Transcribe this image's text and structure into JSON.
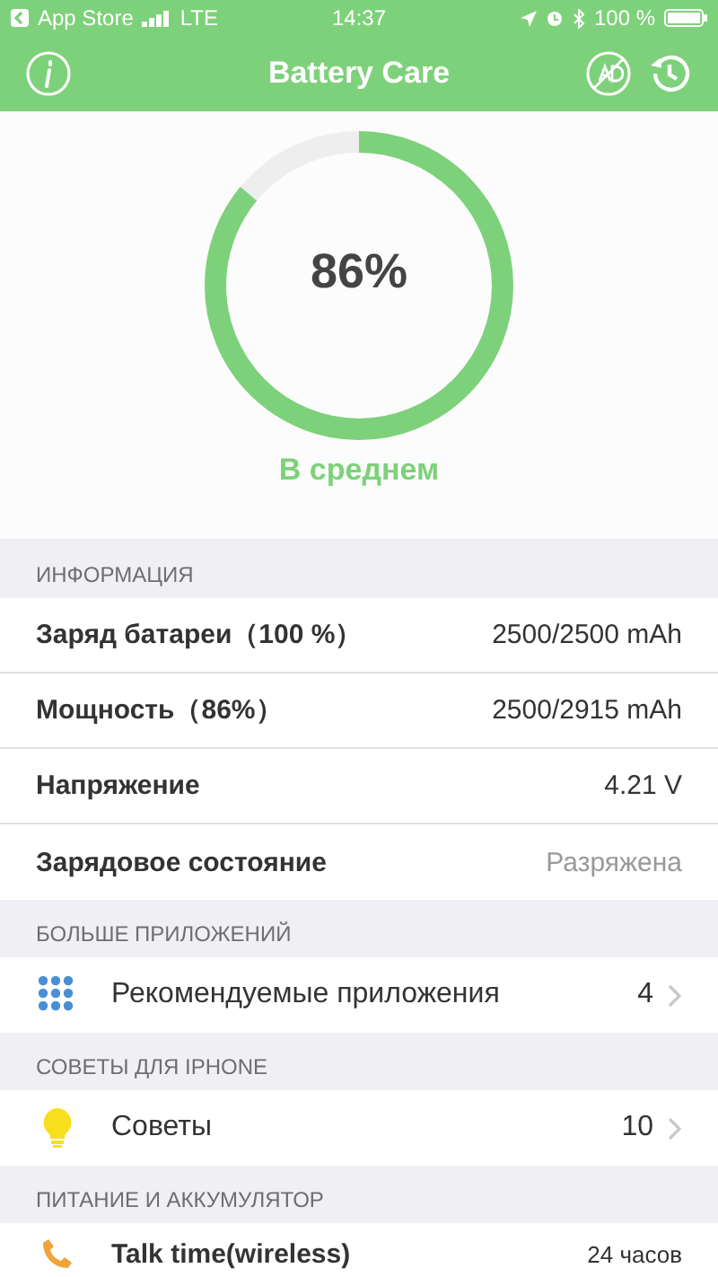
{
  "status_bar": {
    "back_label": "App Store",
    "network": "LTE",
    "time": "14:37",
    "battery": "100 %"
  },
  "nav_bar": {
    "title": "Battery Care"
  },
  "gauge": {
    "level": 0.86,
    "percent": "86%",
    "status": "В среднем"
  },
  "sections": [
    {
      "header": "ИНФОРМАЦИЯ",
      "rows": [
        {
          "kind": "info",
          "label": "Заряд батареи（100 %）",
          "value": "2500/2500 mAh",
          "muted": false
        },
        {
          "kind": "info",
          "label": "Мощность（86%）",
          "value": "2500/2915 mAh",
          "muted": false
        },
        {
          "kind": "info",
          "label": "Напряжение",
          "value": "4.21 V",
          "muted": false
        },
        {
          "kind": "info",
          "label": "Зарядовое состояние",
          "value": "Разряжена",
          "muted": true
        }
      ]
    },
    {
      "header": "БОЛЬШЕ ПРИЛОЖЕНИЙ",
      "rows": [
        {
          "kind": "apps",
          "label": "Рекомендуемые приложения",
          "value": "4"
        }
      ]
    },
    {
      "header": "СОВЕТЫ ДЛЯ IPHONE",
      "rows": [
        {
          "kind": "tips",
          "label": "Советы",
          "value": "10"
        }
      ]
    },
    {
      "header": "ПИТАНИЕ И АККУМУЛЯТОР",
      "rows": [
        {
          "kind": "talk",
          "label": "Talk time(wireless)",
          "value": "24 часов"
        }
      ]
    }
  ]
}
